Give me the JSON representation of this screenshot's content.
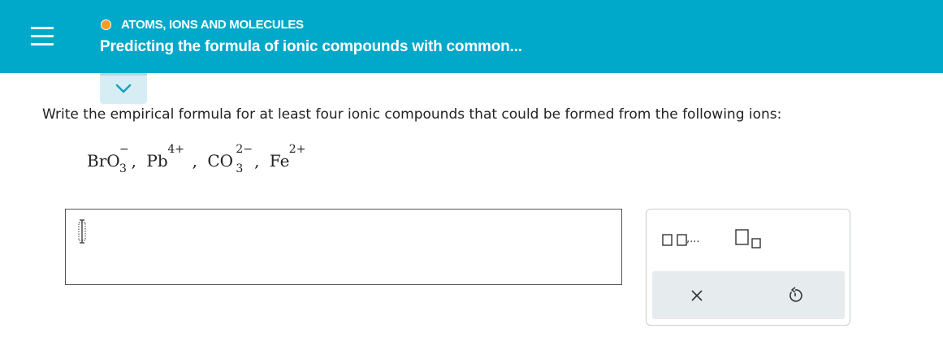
{
  "header": {
    "topic": "ATOMS, IONS AND MOLECULES",
    "title": "Predicting the formula of ionic compounds with common...",
    "menu_icon": "hamburger-menu-icon",
    "status_icon": "in-progress-dot-icon",
    "status_color": "#ff9a1f",
    "accent_color": "#00a9c9"
  },
  "collapse_tab": {
    "icon": "chevron-down-icon"
  },
  "question": {
    "prompt": "Write the empirical formula for at least four ionic compounds that could be formed from the following ions:",
    "ions": [
      {
        "base": "BrO",
        "sub": "3",
        "sup": "−"
      },
      {
        "base": "Pb",
        "sub": "",
        "sup": "4+"
      },
      {
        "base": "CO",
        "sub": "3",
        "sup": "2−"
      },
      {
        "base": "Fe",
        "sub": "",
        "sup": "2+"
      }
    ],
    "separator": ","
  },
  "answer": {
    "value": "",
    "cursor_icon": "text-cursor-icon"
  },
  "palette": {
    "sequence_label": ",...",
    "buttons": {
      "sequence": "list-of-boxes-icon",
      "subscript": "subscript-box-icon",
      "clear": "x-clear-icon",
      "undo": "undo-icon"
    }
  }
}
